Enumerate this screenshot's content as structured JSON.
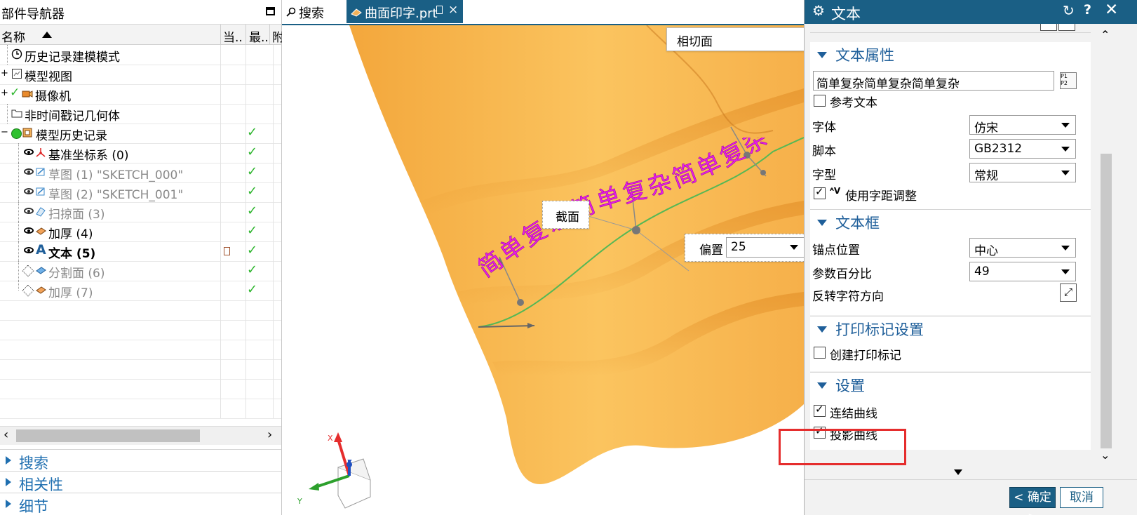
{
  "navigator": {
    "title": "部件导航器",
    "columns": {
      "name": "名称",
      "current": "当..",
      "latest": "最..",
      "dep": "附"
    },
    "rows": [
      {
        "label": "历史记录建模模式",
        "icon": "clock-icon",
        "style": "normal",
        "check": ""
      },
      {
        "label": "模型视图",
        "icon": "model-view-icon",
        "style": "normal",
        "check": ""
      },
      {
        "label": "摄像机",
        "icon": "camera-icon",
        "style": "normal",
        "check": ""
      },
      {
        "label": "非时间戳记几何体",
        "icon": "folder-icon",
        "style": "normal",
        "check": ""
      },
      {
        "label": "模型历史记录",
        "icon": "history-icon",
        "style": "normal",
        "check": "✓"
      },
      {
        "label": "基准坐标系 (0)",
        "icon": "datum-csys-icon",
        "style": "normal",
        "check": "✓"
      },
      {
        "label": "草图 (1) \"SKETCH_000\"",
        "icon": "sketch-icon",
        "style": "dim",
        "check": "✓"
      },
      {
        "label": "草图 (2) \"SKETCH_001\"",
        "icon": "sketch-icon",
        "style": "dim",
        "check": "✓"
      },
      {
        "label": "扫掠面 (3)",
        "icon": "swept-icon",
        "style": "dim",
        "check": "✓"
      },
      {
        "label": "加厚 (4)",
        "icon": "thicken-icon",
        "style": "normal",
        "check": "✓"
      },
      {
        "label": "文本 (5)",
        "icon": "text-icon",
        "style": "bold",
        "check": "✓"
      },
      {
        "label": "分割面 (6)",
        "icon": "divide-face-icon",
        "style": "dim",
        "check": "✓"
      },
      {
        "label": "加厚 (7)",
        "icon": "thicken-icon",
        "style": "dim",
        "check": "✓"
      }
    ],
    "groups": [
      "搜索",
      "相关性",
      "细节"
    ]
  },
  "tabs": {
    "search": "搜索",
    "document": "曲面印字.prt"
  },
  "viewport": {
    "face_option": "相切面",
    "section_label": "截面",
    "offset_label": "偏置",
    "offset_value": "25",
    "embossed_text": "简单复杂简单复杂简单复杂",
    "axis_x": "X",
    "axis_y": "Y",
    "axis_z": "Z"
  },
  "dialog": {
    "title": "文本",
    "text_properties": {
      "header": "文本属性",
      "text_value": "简单复杂简单复杂简单复杂",
      "reference_text": "参考文本",
      "font_label": "字体",
      "font_value": "仿宋",
      "script_label": "脚本",
      "script_value": "GB2312",
      "style_label": "字型",
      "style_value": "常规",
      "kerning_label": "使用字距调整"
    },
    "text_frame": {
      "header": "文本框",
      "anchor_label": "锚点位置",
      "anchor_value": "中心",
      "percent_label": "参数百分比",
      "percent_value": "49",
      "reverse_label": "反转字符方向"
    },
    "imprint": {
      "header": "打印标记设置",
      "create_label": "创建打印标记"
    },
    "settings": {
      "header": "设置",
      "join_label": "连结曲线",
      "project_label": "投影曲线"
    },
    "ok_label": "< 确定 >",
    "cancel_label": "取消"
  },
  "colors": {
    "accent": "#1a5f85",
    "surface": "#f8b84e",
    "text_magenta": "#e81ce8",
    "highlight": "#e52d2d"
  }
}
